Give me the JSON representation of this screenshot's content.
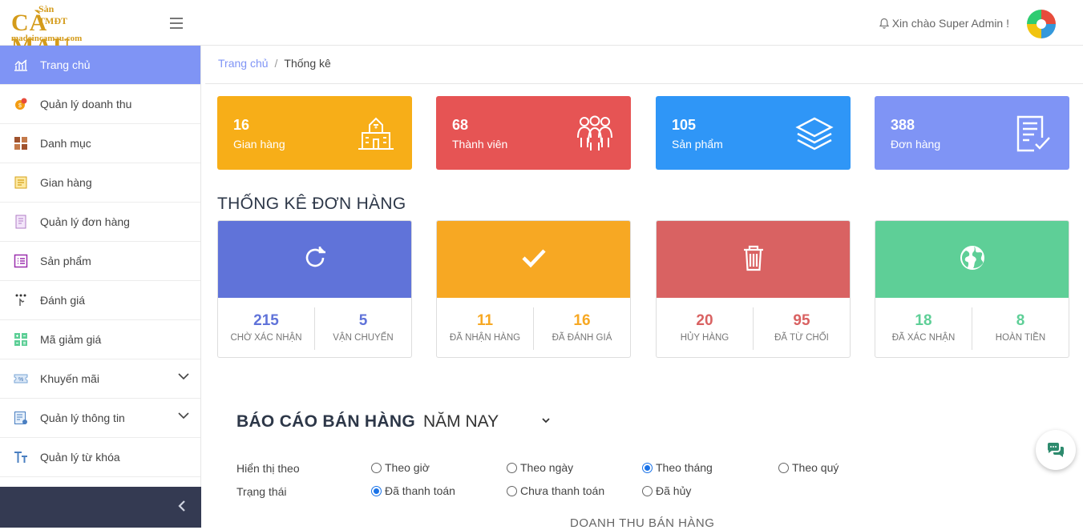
{
  "logo": {
    "line1": "Sàn TMĐT",
    "line2": "CÀ MAU",
    "line3": "madeincamau.com"
  },
  "header": {
    "greeting": "Xin chào Super Admin !"
  },
  "sidebar": {
    "items": [
      {
        "label": "Trang chủ",
        "icon": "chart-icon"
      },
      {
        "label": "Quản lý doanh thu",
        "icon": "revenue-icon"
      },
      {
        "label": "Danh mục",
        "icon": "category-icon"
      },
      {
        "label": "Gian hàng",
        "icon": "store-icon"
      },
      {
        "label": "Quản lý đơn hàng",
        "icon": "order-icon"
      },
      {
        "label": "Sản phẩm",
        "icon": "product-icon"
      },
      {
        "label": "Đánh giá",
        "icon": "rating-icon"
      },
      {
        "label": "Mã giảm giá",
        "icon": "coupon-icon"
      },
      {
        "label": "Khuyến mãi",
        "icon": "promotion-icon"
      },
      {
        "label": "Quản lý thông tin",
        "icon": "info-icon"
      },
      {
        "label": "Quản lý từ khóa",
        "icon": "keyword-icon"
      }
    ]
  },
  "breadcrumb": {
    "home": "Trang chủ",
    "separator": "/",
    "current": "Thống kê"
  },
  "stats": [
    {
      "value": "16",
      "label": "Gian hàng",
      "color": "#f7ae18",
      "icon": "building-icon"
    },
    {
      "value": "68",
      "label": "Thành viên",
      "color": "#e65454",
      "icon": "people-icon"
    },
    {
      "value": "105",
      "label": "Sản phẩm",
      "color": "#2f96f7",
      "icon": "layers-icon"
    },
    {
      "value": "388",
      "label": "Đơn hàng",
      "color": "#7f94f5",
      "icon": "checklist-icon"
    }
  ],
  "orders_title": "THỐNG KÊ ĐƠN HÀNG",
  "order_cards": [
    {
      "color": "#6073d9",
      "icon": "refresh-icon",
      "items": [
        {
          "value": "215",
          "label": "CHỜ XÁC NHẬN"
        },
        {
          "value": "5",
          "label": "VẬN CHUYỂN"
        }
      ]
    },
    {
      "color": "#f7a823",
      "icon": "check-icon",
      "items": [
        {
          "value": "11",
          "label": "ĐÃ NHẬN HÀNG"
        },
        {
          "value": "16",
          "label": "ĐÃ ĐÁNH GIÁ"
        }
      ]
    },
    {
      "color": "#d96262",
      "icon": "trash-icon",
      "items": [
        {
          "value": "20",
          "label": "HỦY HÀNG"
        },
        {
          "value": "95",
          "label": "ĐÃ TỪ CHỐI"
        }
      ]
    },
    {
      "color": "#5ecf97",
      "icon": "globe-icon",
      "items": [
        {
          "value": "18",
          "label": "ĐÃ XÁC NHẬN"
        },
        {
          "value": "8",
          "label": "HOÀN TIỀN"
        }
      ]
    }
  ],
  "report": {
    "title": "BÁO CÁO BÁN HÀNG",
    "period": "NĂM NAY"
  },
  "filters": {
    "display_label": "Hiển thị theo",
    "display_options": [
      {
        "label": "Theo giờ",
        "checked": false
      },
      {
        "label": "Theo ngày",
        "checked": false
      },
      {
        "label": "Theo tháng",
        "checked": true
      },
      {
        "label": "Theo quý",
        "checked": false
      }
    ],
    "status_label": "Trạng thái",
    "status_options": [
      {
        "label": "Đã thanh toán",
        "checked": true
      },
      {
        "label": "Chưa thanh toán",
        "checked": false
      },
      {
        "label": "Đã hủy",
        "checked": false
      }
    ]
  },
  "chart_title": "DOANH THU BÁN HÀNG"
}
